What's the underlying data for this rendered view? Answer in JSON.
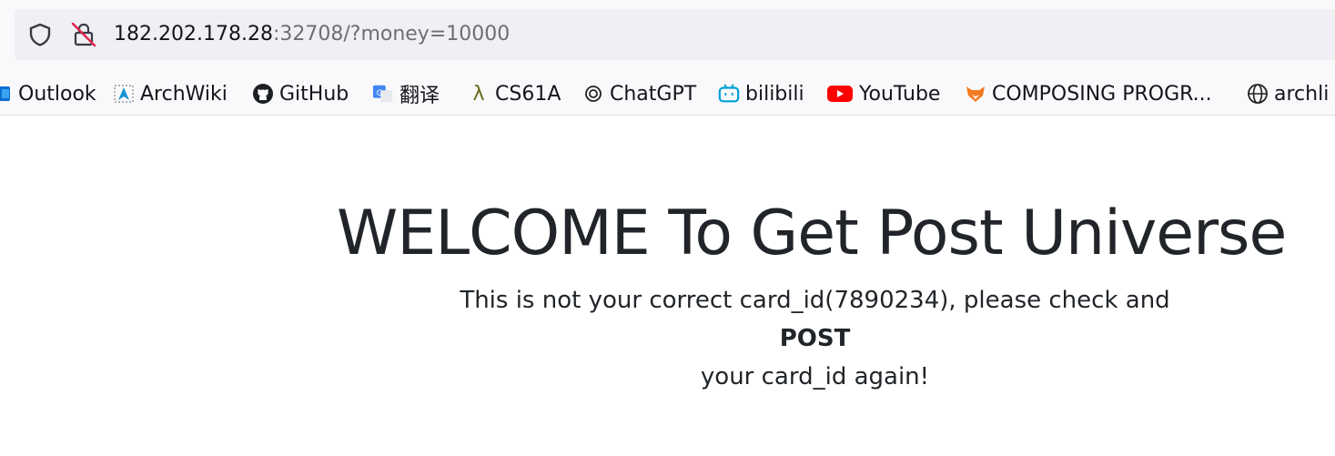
{
  "browser": {
    "url_host": "182.202.178.28",
    "url_rest": ":32708/?money=10000",
    "icons": [
      "shield-icon",
      "insecure-lock-icon"
    ]
  },
  "bookmarks": [
    {
      "label": "Outlook",
      "icon": "outlook-icon"
    },
    {
      "label": "ArchWiki",
      "icon": "archwiki-icon"
    },
    {
      "label": "GitHub",
      "icon": "github-icon"
    },
    {
      "label": "翻译",
      "icon": "translate-icon"
    },
    {
      "label": "CS61A",
      "icon": "lambda-icon"
    },
    {
      "label": "ChatGPT",
      "icon": "chatgpt-icon"
    },
    {
      "label": "bilibili",
      "icon": "bilibili-icon"
    },
    {
      "label": "YouTube",
      "icon": "youtube-icon"
    },
    {
      "label": "COMPOSING PROGR...",
      "icon": "fox-icon"
    },
    {
      "label": "archli",
      "icon": "globe-icon"
    }
  ],
  "page": {
    "title": "WELCOME To Get Post Universe",
    "line1": "This is not your correct card_id(7890234), please check and",
    "line2": "POST",
    "line3": "your card_id again!"
  },
  "colors": {
    "toolbar_bg": "#f9f9fb",
    "urlbar_bg": "#f0f0f4",
    "text": "#212529",
    "youtube_red": "#ff0000",
    "bilibili_blue": "#00a1d6"
  }
}
